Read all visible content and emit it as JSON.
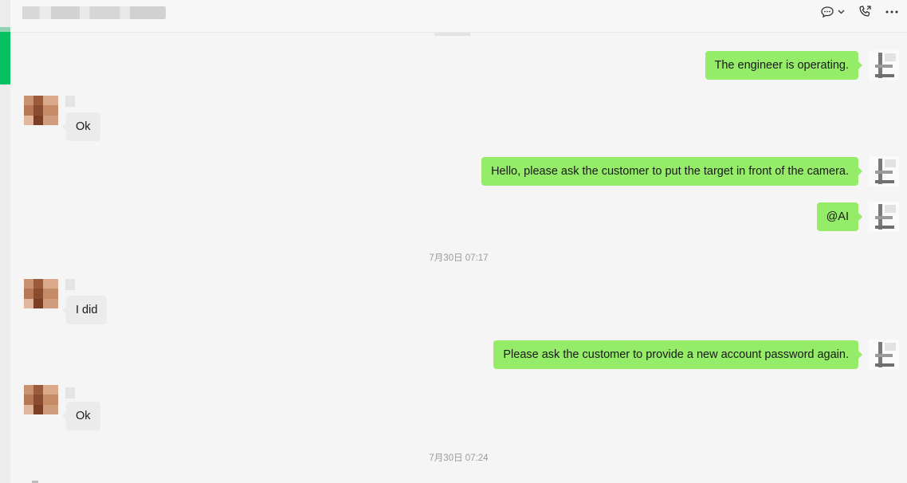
{
  "window": {
    "title": "",
    "icons": [
      "chat-options-icon",
      "chevron-down-icon",
      "voice-call-icon",
      "more-icon"
    ]
  },
  "messages": [
    {
      "side": "out",
      "text": "The engineer is operating."
    },
    {
      "side": "in",
      "text": "Ok"
    },
    {
      "side": "out",
      "text": "Hello, please ask the customer to put the target in front of the camera."
    },
    {
      "side": "out",
      "text": "@AI"
    },
    {
      "side": "time",
      "text": "7月30日 07:17"
    },
    {
      "side": "in",
      "text": "I did"
    },
    {
      "side": "out",
      "text": "Please ask the customer to provide a new account password again."
    },
    {
      "side": "in",
      "text": "Ok"
    },
    {
      "side": "time",
      "text": "7月30日 07:24"
    }
  ],
  "colors": {
    "outgoing_bubble": "#95ec69",
    "incoming_bubble": "#ebebeb",
    "accent": "#07c160",
    "background": "#f5f5f5"
  }
}
